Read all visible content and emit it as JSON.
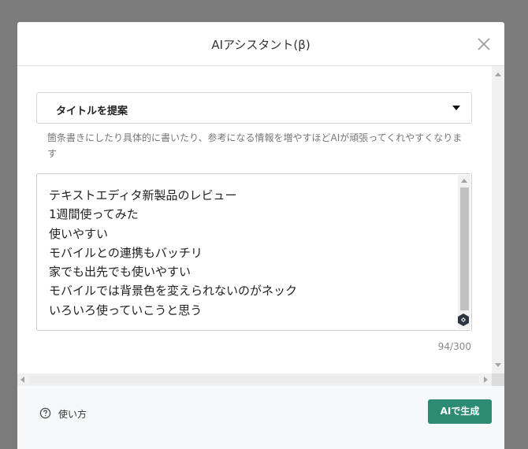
{
  "modal": {
    "title": "AIアシスタント(β)"
  },
  "select": {
    "value": "タイトルを提案"
  },
  "hint": "箇条書きにしたり具体的に書いたり、参考になる情報を増やすほどAIが頑張ってくれやすくなります",
  "textarea": {
    "lines": [
      "テキストエディタ新製品のレビュー",
      "1週間使ってみた",
      "使いやすい",
      "モバイルとの連携もバッチリ",
      "家でも出先でも使いやすい",
      "モバイルでは背景色を変えられないのがネック",
      "いろいろ使っていこうと思う"
    ],
    "counter": "94/300"
  },
  "footer": {
    "help_label": "使い方",
    "generate_label": "AIで生成"
  },
  "colors": {
    "overlay": "#7b7b7b",
    "primary_button": "#2d8a73",
    "footer_bg": "#f6f8f9",
    "ai_badge": "#2b3440"
  },
  "icons": {
    "close": "close-icon",
    "caret": "caret-down-icon",
    "help": "help-circle-icon",
    "ai_badge": "ai-badge-icon"
  }
}
